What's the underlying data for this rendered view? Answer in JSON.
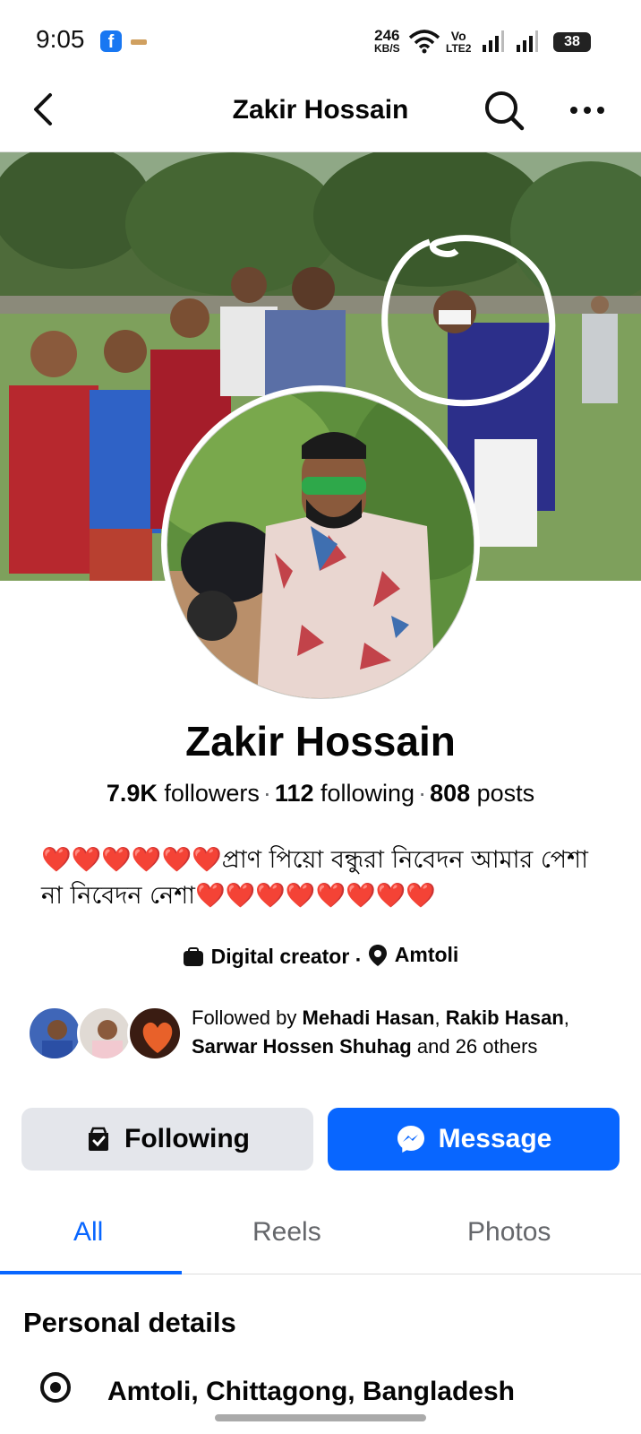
{
  "status_bar": {
    "time": "9:05",
    "net_speed_value": "246",
    "net_speed_unit": "KB/S",
    "volte_label": "Vo",
    "volte_sub": "LTE2",
    "battery": "38"
  },
  "header": {
    "title": "Zakir Hossain"
  },
  "profile": {
    "name": "Zakir Hossain",
    "followers_count": "7.9K",
    "followers_label": "followers",
    "following_count": "112",
    "following_label": "following",
    "posts_count": "808",
    "posts_label": "posts",
    "separator": "·",
    "bio": "❤️❤️❤️❤️❤️❤️প্রাণ পিয়ো বন্ধুরা নিবেদন আমার পেশা না নিবেদন নেশা❤️❤️❤️❤️❤️❤️❤️❤️",
    "category": "Digital creator",
    "category_separator": "·",
    "location": "Amtoli"
  },
  "followed_by": {
    "prefix": "Followed by",
    "name1": "Mehadi Hasan",
    "comma": ",",
    "name2": "Rakib Hasan",
    "name3": "Sarwar Hossen Shuhag",
    "suffix": "and 26 others"
  },
  "actions": {
    "following_label": "Following",
    "message_label": "Message"
  },
  "tabs": [
    {
      "label": "All",
      "active": true
    },
    {
      "label": "Reels",
      "active": false
    },
    {
      "label": "Photos",
      "active": false
    }
  ],
  "personal_details": {
    "title": "Personal details",
    "location": "Amtoli, Chittagong, Bangladesh"
  },
  "colors": {
    "accent": "#0866ff",
    "secondary_button": "#e4e6eb",
    "text": "#050505",
    "muted": "#65676b"
  },
  "icons": {
    "back": "chevron-left-icon",
    "search": "search-icon",
    "more": "more-horizontal-icon",
    "category": "briefcase-icon",
    "location": "location-pin-icon",
    "following": "following-check-icon",
    "message": "messenger-icon"
  }
}
